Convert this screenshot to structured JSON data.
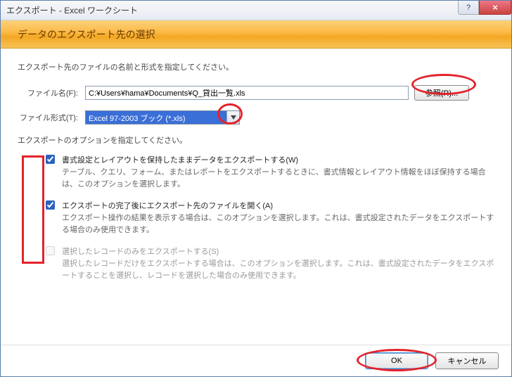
{
  "window": {
    "title": "エクスポート - Excel ワークシート"
  },
  "header": {
    "heading": "データのエクスポート先の選択"
  },
  "instructions": {
    "line1": "エクスポート先のファイルの名前と形式を指定してください。"
  },
  "filename": {
    "label": "ファイル名(F):",
    "value": "C:¥Users¥hama¥Documents¥Q_貸出一覧.xls",
    "browse": "参照(R)..."
  },
  "filetype": {
    "label": "ファイル形式(T):",
    "selected": "Excel 97-2003 ブック (*.xls)"
  },
  "options_header": "エクスポートのオプションを指定してください。",
  "options": [
    {
      "label": "書式設定とレイアウトを保持したままデータをエクスポートする(W)",
      "desc": "テーブル、クエリ、フォーム、またはレポートをエクスポートするときに、書式情報とレイアウト情報をほぼ保持する場合は、このオプションを選択します。",
      "checked": true,
      "enabled": true
    },
    {
      "label": "エクスポートの完了後にエクスポート先のファイルを開く(A)",
      "desc": "エクスポート操作の結果を表示する場合は、このオプションを選択します。これは、書式設定されたデータをエクスポートする場合のみ使用できます。",
      "checked": true,
      "enabled": true
    },
    {
      "label": "選択したレコードのみをエクスポートする(S)",
      "desc": "選択したレコードだけをエクスポートする場合は、このオプションを選択します。これは、書式設定されたデータをエクスポートすることを選択し、レコードを選択した場合のみ使用できます。",
      "checked": false,
      "enabled": false
    }
  ],
  "buttons": {
    "ok": "OK",
    "cancel": "キャンセル"
  }
}
